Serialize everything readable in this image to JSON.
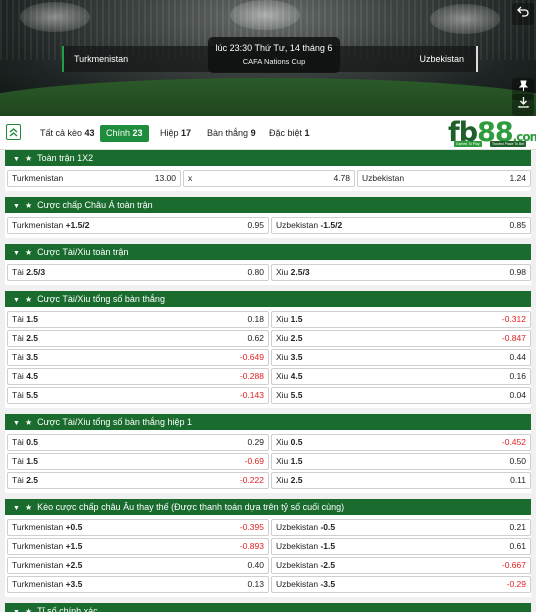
{
  "match": {
    "home_team": "Turkmenistan",
    "away_team": "Uzbekistan",
    "time": "lúc 23:30 Thứ Tư, 14 tháng 6",
    "league": "CAFA Nations Cup"
  },
  "icons": {
    "back": "back-arrow-icon",
    "pin": "pin-icon",
    "download": "download-icon",
    "collapse": "double-chevron-up-icon"
  },
  "tabs": [
    {
      "label": "Tất cả kèo",
      "count": "43",
      "active": false
    },
    {
      "label": "Chính",
      "count": "23",
      "active": true
    },
    {
      "label": "Hiệp",
      "count": "17",
      "active": false
    },
    {
      "label": "Bàn thắng",
      "count": "9",
      "active": false
    },
    {
      "label": "Đặc biệt",
      "count": "1",
      "active": false
    }
  ],
  "logo": {
    "text_fb": "fb",
    "text_num": "88",
    "text_com": ".com",
    "tag1": "Games To Play",
    "tag2": "Trusted Place To Bet"
  },
  "colors": {
    "header_green": "#196b2e",
    "tab_active": "#1e8e3e",
    "negative": "#e02020"
  },
  "sections": {
    "s1": {
      "title": "Toàn trận 1X2",
      "row": [
        {
          "label": "Turkmenistan",
          "odds": "13.00"
        },
        {
          "label": "x",
          "odds": "4.78"
        },
        {
          "label": "Uzbekistan",
          "odds": "1.24"
        }
      ]
    },
    "s2": {
      "title": "Cược chấp Châu Á toàn trận",
      "rows": [
        [
          {
            "label": "Turkmenistan",
            "line": "+1.5/2",
            "odds": "0.95"
          },
          {
            "label": "Uzbekistan",
            "line": "-1.5/2",
            "odds": "0.85"
          }
        ]
      ]
    },
    "s3": {
      "title": "Cược Tài/Xiu toàn trận",
      "rows": [
        [
          {
            "label": "Tài",
            "line": "2.5/3",
            "odds": "0.80"
          },
          {
            "label": "Xiu",
            "line": "2.5/3",
            "odds": "0.98"
          }
        ]
      ]
    },
    "s4": {
      "title": "Cược Tài/Xiu tổng số bàn thắng",
      "rows": [
        [
          {
            "label": "Tài",
            "line": "1.5",
            "odds": "0.18"
          },
          {
            "label": "Xiu",
            "line": "1.5",
            "odds": "-0.312"
          }
        ],
        [
          {
            "label": "Tài",
            "line": "2.5",
            "odds": "0.62"
          },
          {
            "label": "Xiu",
            "line": "2.5",
            "odds": "-0.847"
          }
        ],
        [
          {
            "label": "Tài",
            "line": "3.5",
            "odds": "-0.649"
          },
          {
            "label": "Xiu",
            "line": "3.5",
            "odds": "0.44"
          }
        ],
        [
          {
            "label": "Tài",
            "line": "4.5",
            "odds": "-0.288"
          },
          {
            "label": "Xiu",
            "line": "4.5",
            "odds": "0.16"
          }
        ],
        [
          {
            "label": "Tài",
            "line": "5.5",
            "odds": "-0.143"
          },
          {
            "label": "Xiu",
            "line": "5.5",
            "odds": "0.04"
          }
        ]
      ]
    },
    "s5": {
      "title": "Cược Tài/Xiu tổng số bàn thắng hiệp 1",
      "rows": [
        [
          {
            "label": "Tài",
            "line": "0.5",
            "odds": "0.29"
          },
          {
            "label": "Xiu",
            "line": "0.5",
            "odds": "-0.452"
          }
        ],
        [
          {
            "label": "Tài",
            "line": "1.5",
            "odds": "-0.69"
          },
          {
            "label": "Xiu",
            "line": "1.5",
            "odds": "0.50"
          }
        ],
        [
          {
            "label": "Tài",
            "line": "2.5",
            "odds": "-0.222"
          },
          {
            "label": "Xiu",
            "line": "2.5",
            "odds": "0.11"
          }
        ]
      ]
    },
    "s6": {
      "title": "Kèo cược chấp châu Âu thay thế (Được thanh toán dựa trên tỷ số cuối cùng)",
      "rows": [
        [
          {
            "label": "Turkmenistan",
            "line": "+0.5",
            "odds": "-0.395"
          },
          {
            "label": "Uzbekistan",
            "line": "-0.5",
            "odds": "0.21"
          }
        ],
        [
          {
            "label": "Turkmenistan",
            "line": "+1.5",
            "odds": "-0.893"
          },
          {
            "label": "Uzbekistan",
            "line": "-1.5",
            "odds": "0.61"
          }
        ],
        [
          {
            "label": "Turkmenistan",
            "line": "+2.5",
            "odds": "0.40"
          },
          {
            "label": "Uzbekistan",
            "line": "-2.5",
            "odds": "-0.667"
          }
        ],
        [
          {
            "label": "Turkmenistan",
            "line": "+3.5",
            "odds": "0.13"
          },
          {
            "label": "Uzbekistan",
            "line": "-3.5",
            "odds": "-0.29"
          }
        ]
      ]
    },
    "s7": {
      "title": "Tỉ số chính xác"
    }
  }
}
